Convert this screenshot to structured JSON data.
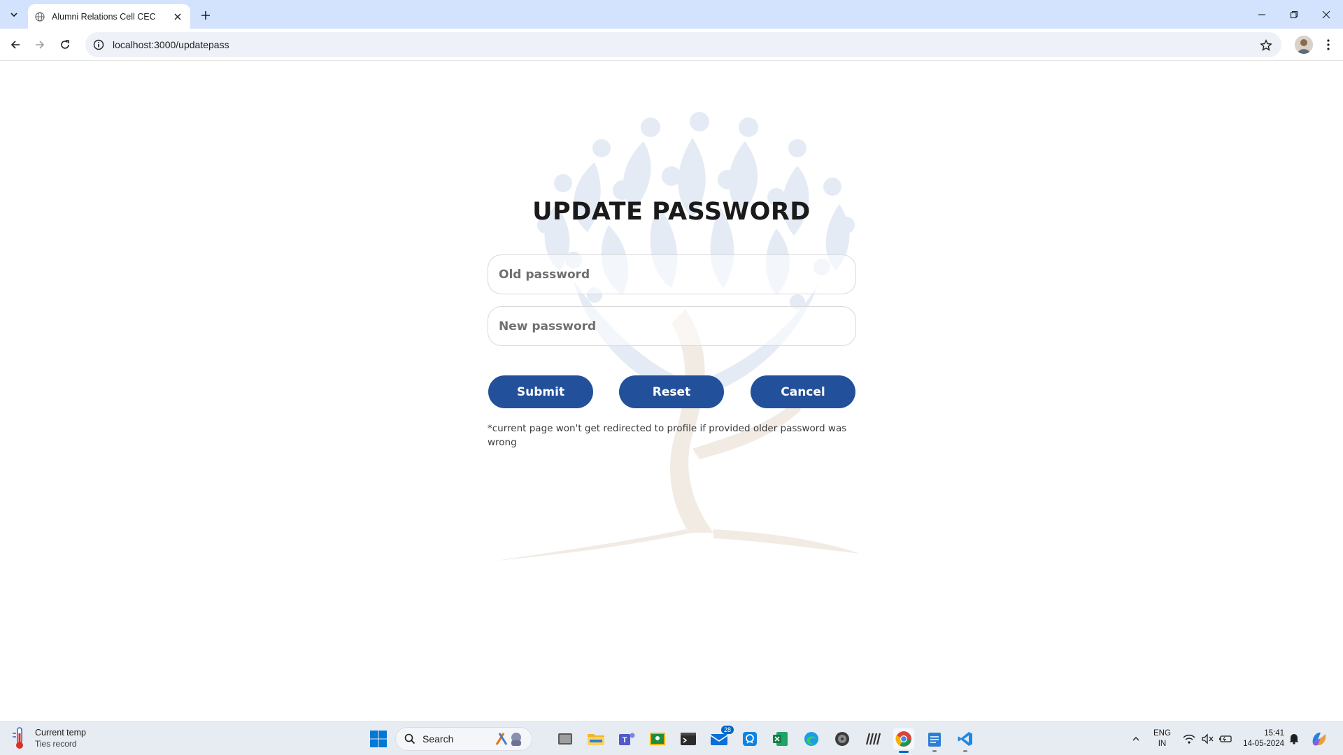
{
  "browser": {
    "tab_title": "Alumni Relations Cell CEC",
    "url": "localhost:3000/updatepass"
  },
  "page": {
    "title": "UPDATE PASSWORD",
    "old_password_placeholder": "Old password",
    "new_password_placeholder": "New password",
    "submit_label": "Submit",
    "reset_label": "Reset",
    "cancel_label": "Cancel",
    "note": "*current page won't get redirected to profile if provided older password was wrong",
    "accent_color": "#22509b"
  },
  "taskbar": {
    "weather_title": "Current temp",
    "weather_sub": "Ties record",
    "search_label": "Search",
    "mail_badge": "28",
    "lang_line1": "ENG",
    "lang_line2": "IN",
    "time": "15:41",
    "date": "14-05-2024"
  }
}
